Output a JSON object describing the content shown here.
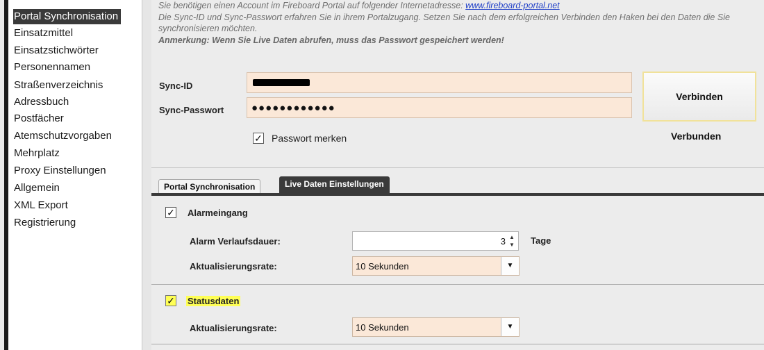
{
  "sidebar": {
    "items": [
      {
        "label": "Portal Synchronisation",
        "selected": true
      },
      {
        "label": "Einsatzmittel"
      },
      {
        "label": "Einsatzstichwörter"
      },
      {
        "label": "Personennamen"
      },
      {
        "label": "Straßenverzeichnis"
      },
      {
        "label": "Adressbuch"
      },
      {
        "label": "Postfächer"
      },
      {
        "label": "Atemschutzvorgaben"
      },
      {
        "label": "Mehrplatz"
      },
      {
        "label": "Proxy Einstellungen"
      },
      {
        "label": "Allgemein"
      },
      {
        "label": "XML Export"
      },
      {
        "label": "Registrierung"
      }
    ]
  },
  "info": {
    "line1_text": "Sie benötigen einen Account im Fireboard Portal auf folgender Internetadresse: ",
    "line1_link": "www.fireboard-portal.net",
    "line2": "Die Sync-ID und Sync-Passwort erfahren Sie in ihrem Portalzugang. Setzen Sie nach dem erfolgreichen Verbinden den Haken bei den Daten die Sie synchronisieren möchten.",
    "note": "Anmerkung: Wenn Sie Live Daten abrufen, muss das Passwort gespeichert werden!"
  },
  "sync": {
    "id_label": "Sync-ID",
    "password_label": "Sync-Passwort",
    "password_mask": "●●●●●●●●●●●●",
    "remember_label": "Passwort merken",
    "remember_checked": true,
    "connect_label": "Verbinden",
    "status": "Verbunden"
  },
  "tabs": [
    {
      "label": "Portal Synchronisation",
      "active": true
    },
    {
      "label": "Live Daten Einstellungen",
      "active": false
    }
  ],
  "alarm": {
    "label": "Alarmeingang",
    "checked": true,
    "duration_label": "Alarm Verlaufsdauer:",
    "duration_value": "3",
    "duration_unit": "Tage",
    "rate_label": "Aktualisierungsrate:",
    "rate_value": "10 Sekunden"
  },
  "status": {
    "label": "Statusdaten",
    "checked": true,
    "rate_label": "Aktualisierungsrate:",
    "rate_value": "10 Sekunden"
  },
  "colors": {
    "selection": "#3a3a3a",
    "field_bg": "#fbe8d8",
    "highlight": "#ffff55",
    "link": "#1f3fc7"
  },
  "icons": {
    "check": "✓",
    "spin_up": "▲",
    "spin_down": "▼",
    "dropdown": "▼"
  }
}
